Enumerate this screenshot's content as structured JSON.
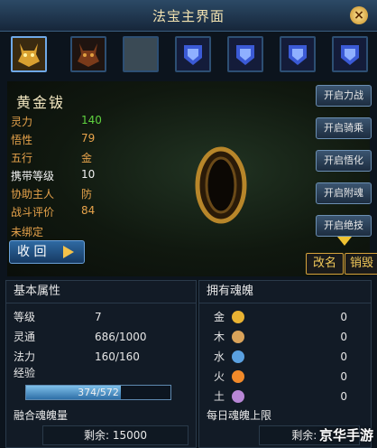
{
  "window": {
    "title": "法宝主界面",
    "close_icon": "close-icon"
  },
  "slots": [
    {
      "icon": "golden-beast-head-icon",
      "selected": true
    },
    {
      "icon": "dark-beast-head-icon",
      "selected": false
    },
    {
      "icon": "empty-slot",
      "selected": false
    },
    {
      "icon": "blue-armor-icon",
      "selected": false
    },
    {
      "icon": "blue-armor-icon",
      "selected": false
    },
    {
      "icon": "blue-armor-icon",
      "selected": false
    },
    {
      "icon": "blue-armor-icon",
      "selected": false
    }
  ],
  "item": {
    "name": "黄金钹",
    "attributes": [
      {
        "label": "灵力",
        "value": "140"
      },
      {
        "label": "悟性",
        "value": "79"
      },
      {
        "label": "五行",
        "value": "金"
      },
      {
        "label": "携带等级",
        "value": "10"
      },
      {
        "label": "协助主人",
        "value": "防"
      },
      {
        "label": "战斗评价",
        "value": "84"
      }
    ],
    "bind_status": "未绑定"
  },
  "recall_button": "收 回",
  "side_buttons": [
    "开启力战",
    "开启骑乘",
    "开启悟化",
    "开启附魂",
    "开启绝技"
  ],
  "actions": {
    "rename": "改名",
    "destroy": "销毁"
  },
  "basic": {
    "header": "基本属性",
    "rows": [
      {
        "label": "等级",
        "value": "7"
      },
      {
        "label": "灵通",
        "value": "686/1000"
      },
      {
        "label": "法力",
        "value": "160/160"
      }
    ],
    "exp_label": "经验",
    "exp_text": "374/572",
    "exp_fraction": 0.654
  },
  "souls": {
    "header": "拥有魂魄",
    "items": [
      {
        "label": "金",
        "value": "0",
        "color": "#e8b233"
      },
      {
        "label": "木",
        "value": "0",
        "color": "#d9a35a"
      },
      {
        "label": "水",
        "value": "0",
        "color": "#5aa0e0"
      },
      {
        "label": "火",
        "value": "0",
        "color": "#f08a2a"
      },
      {
        "label": "土",
        "value": "0",
        "color": "#b887d6"
      }
    ]
  },
  "fusion": {
    "label": "融合魂魄量",
    "remaining": "剩余: 15000"
  },
  "daily": {
    "label": "每日魂魄上限",
    "remaining": "剩余: 1"
  },
  "watermark": "京华手游"
}
